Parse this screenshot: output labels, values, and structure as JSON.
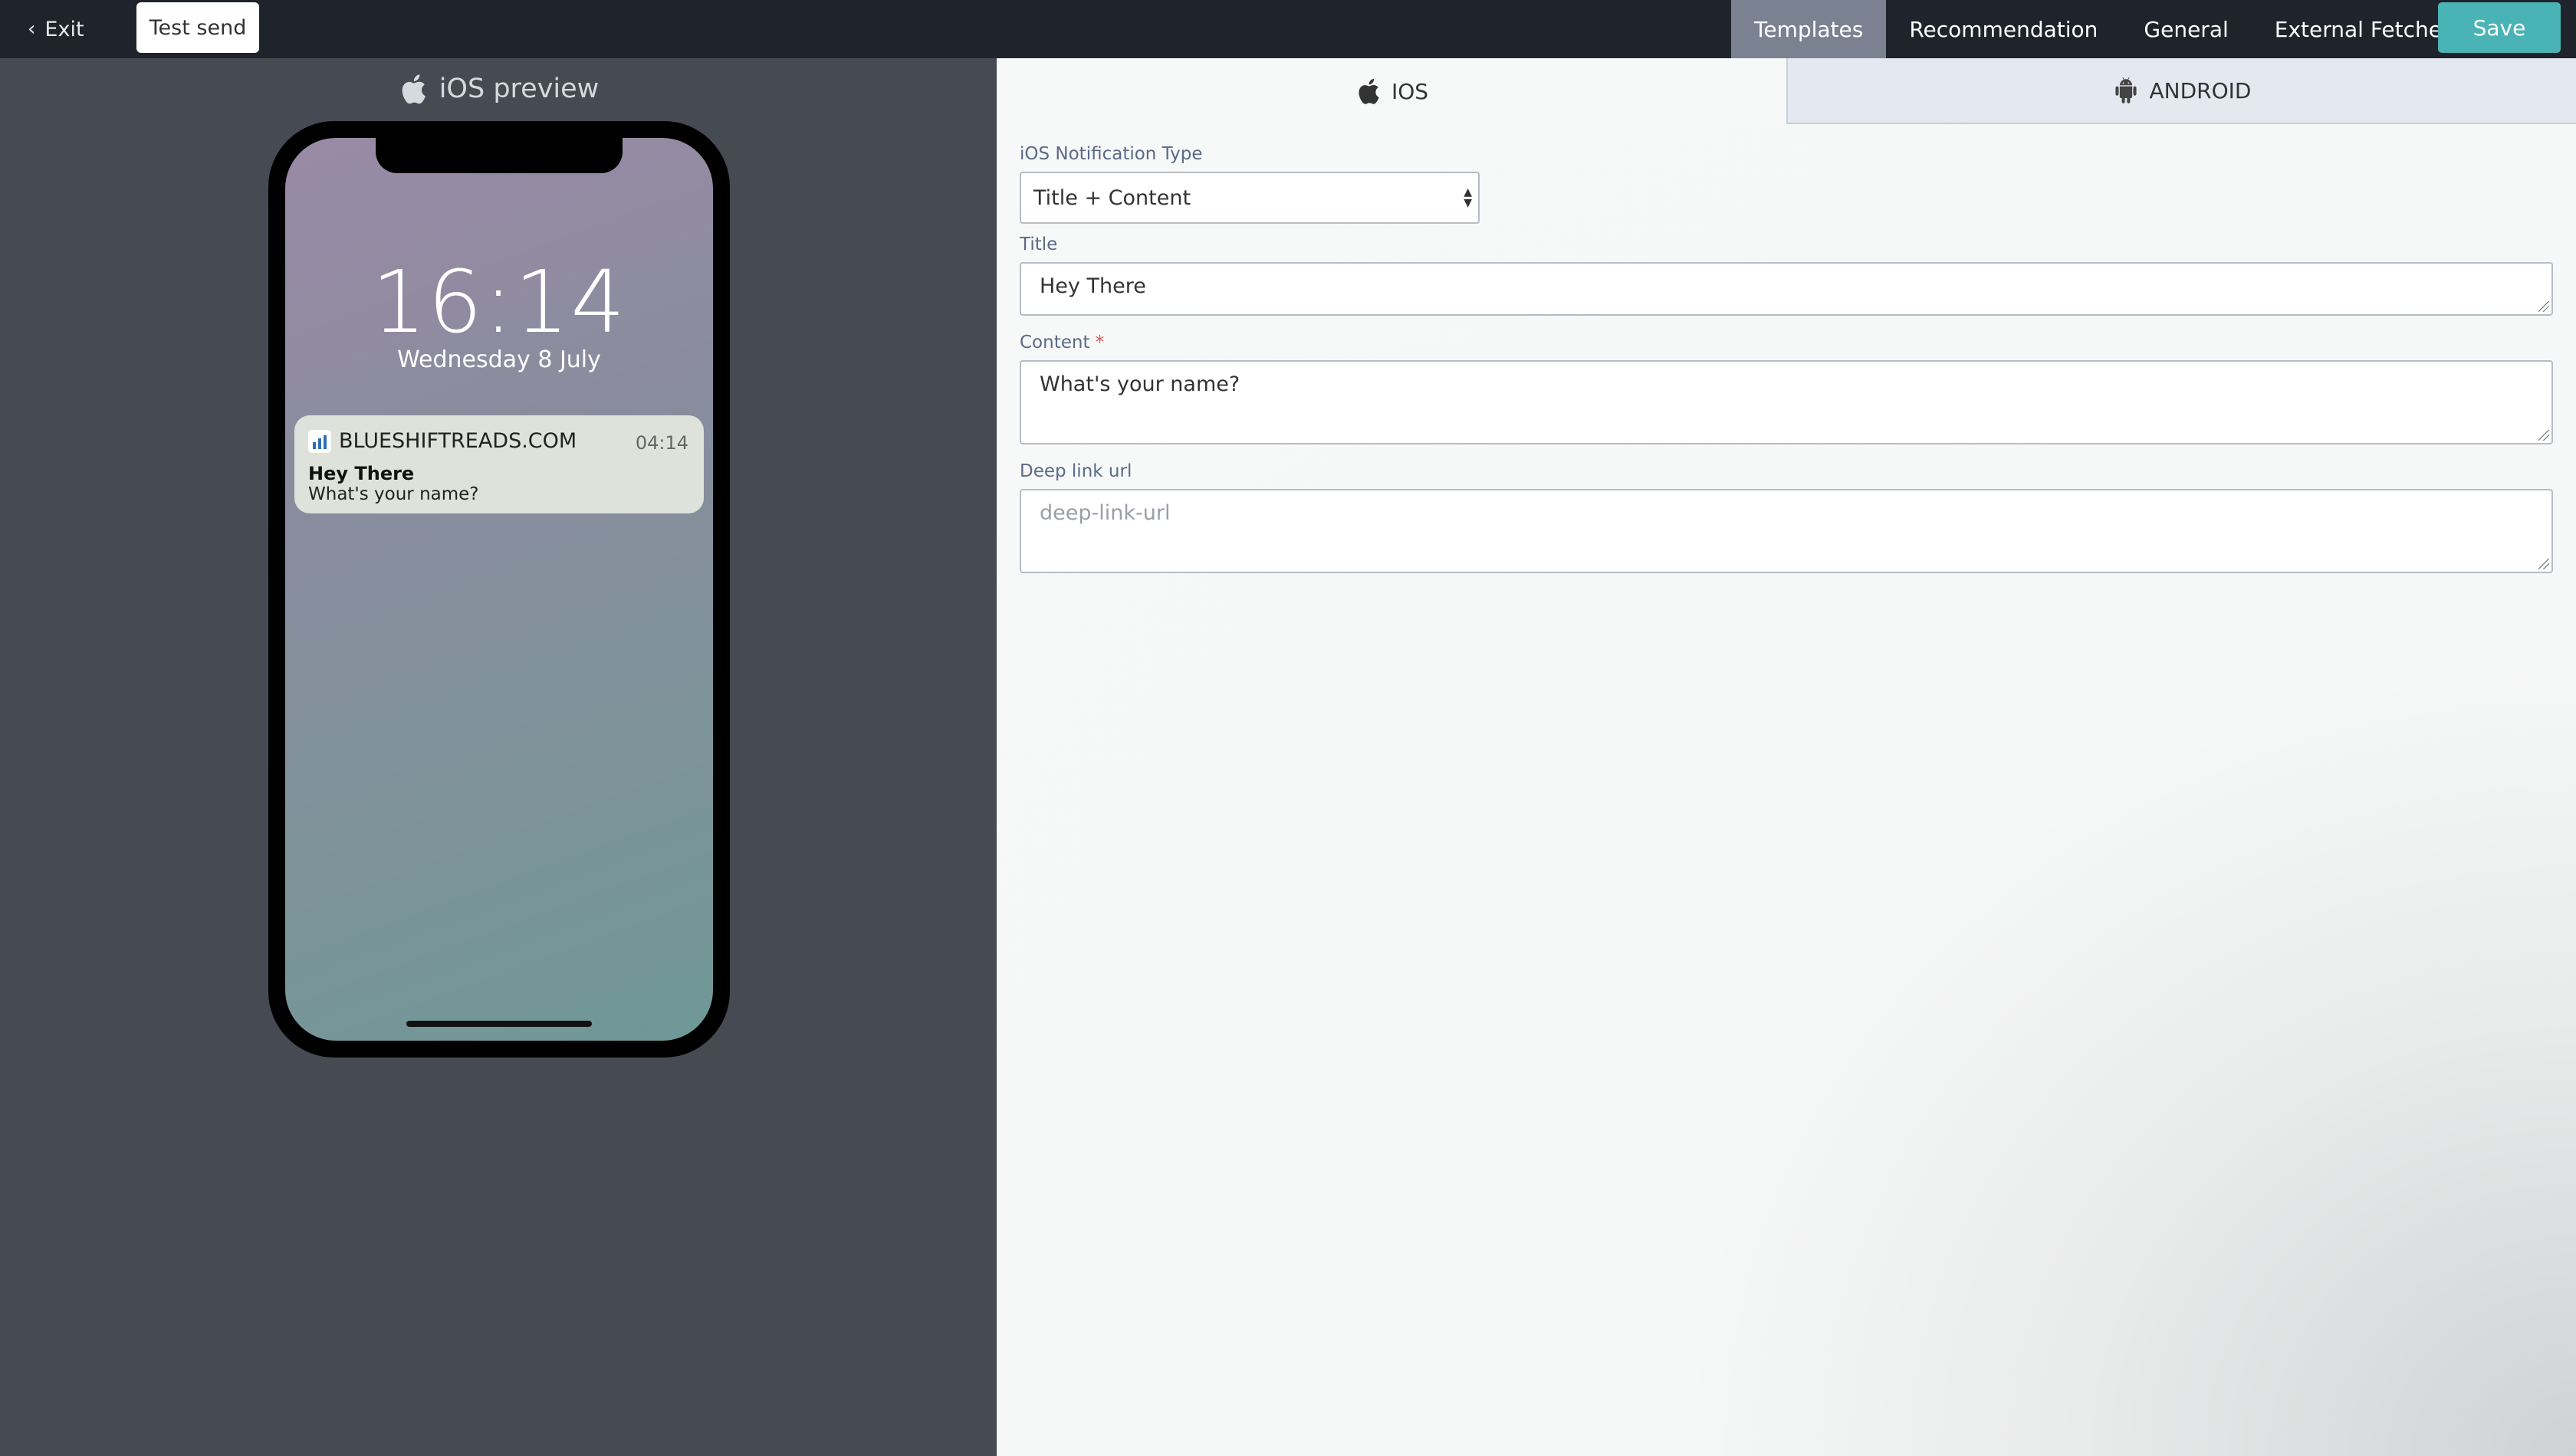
{
  "topbar": {
    "exit_label": "Exit",
    "test_send_label": "Test send",
    "nav_tabs": [
      {
        "label": "Templates",
        "active": true
      },
      {
        "label": "Recommendation",
        "active": false
      },
      {
        "label": "General",
        "active": false
      },
      {
        "label": "External Fetches",
        "active": false
      }
    ],
    "save_label": "Save"
  },
  "preview": {
    "title": "iOS preview",
    "time": "16:14",
    "date": "Wednesday 8 July",
    "notification": {
      "app_name": "BLUESHIFTREADS.COM",
      "time": "04:14",
      "title": "Hey There",
      "body": "What's your name?"
    }
  },
  "editor": {
    "tabs": [
      {
        "label": "IOS",
        "icon": "apple-icon",
        "active": true
      },
      {
        "label": "ANDROID",
        "icon": "android-icon",
        "active": false
      }
    ],
    "notification_type": {
      "label": "iOS Notification Type",
      "value": "Title + Content"
    },
    "title_field": {
      "label": "Title",
      "value": "Hey There"
    },
    "content_field": {
      "label": "Content",
      "required_mark": "*",
      "value": "What's your name?"
    },
    "deep_link_field": {
      "label": "Deep link url",
      "placeholder": "deep-link-url"
    }
  },
  "colors": {
    "topbar": "#1f232b",
    "active_nav": "#7a8291",
    "save": "#4ab3b5",
    "preview_bg": "#454a53"
  }
}
